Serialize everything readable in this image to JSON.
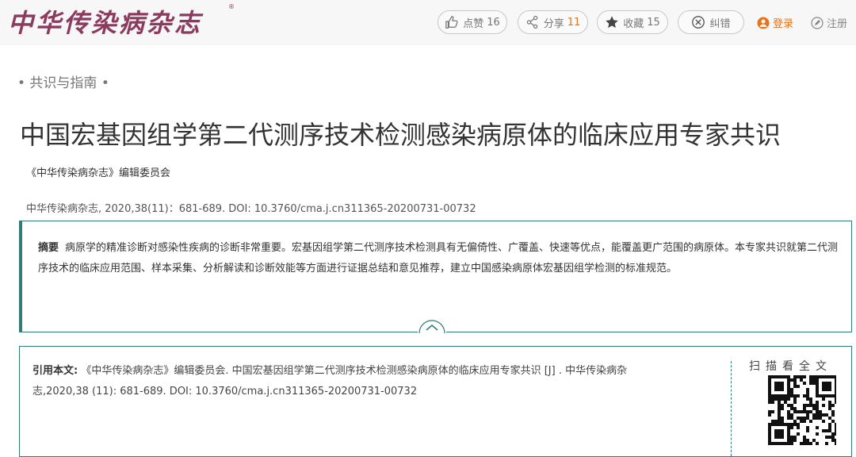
{
  "header": {
    "logo_text": "中华传染病杂志",
    "logo_mark": "®",
    "actions": {
      "like_label": "点赞",
      "like_count": "16",
      "share_label": "分享",
      "share_count": "11",
      "fav_label": "收藏",
      "fav_count": "15",
      "error_label": "纠错"
    },
    "login_label": "登录",
    "register_label": "注册"
  },
  "article": {
    "category": "• 共识与指南 •",
    "title": "中国宏基因组学第二代测序技术检测感染病原体的临床应用专家共识",
    "authors": "《中华传染病杂志》编辑委员会",
    "citation_line": "中华传染病杂志, 2020,38(11)：681-689. DOI: 10.3760/cma.j.cn311365-20200731-00732",
    "abstract_label": "摘要",
    "abstract_text": "病原学的精准诊断对感染性疾病的诊断非常重要。宏基因组学第二代测序技术检测具有无偏倚性、广覆盖、快速等优点，能覆盖更广范围的病原体。本专家共识就第二代测序技术的临床应用范围、样本采集、分析解读和诊断效能等方面进行证据总结和意见推荐，建立中国感染病原体宏基因组学检测的标准规范。"
  },
  "cite": {
    "label": "引用本文:",
    "text": " 《中华传染病杂志》编辑委员会. 中国宏基因组学第二代测序技术检测感染病原体的临床应用专家共识 [J] . 中华传染病杂志,2020,38 (11): 681-689. DOI: 10.3760/cma.j.cn311365-20200731-00732",
    "scan_label": "扫描看全文"
  },
  "colors": {
    "accent_teal": "#2f7c79",
    "accent_orange": "#e8731a",
    "logo": "#8c3b5f"
  }
}
